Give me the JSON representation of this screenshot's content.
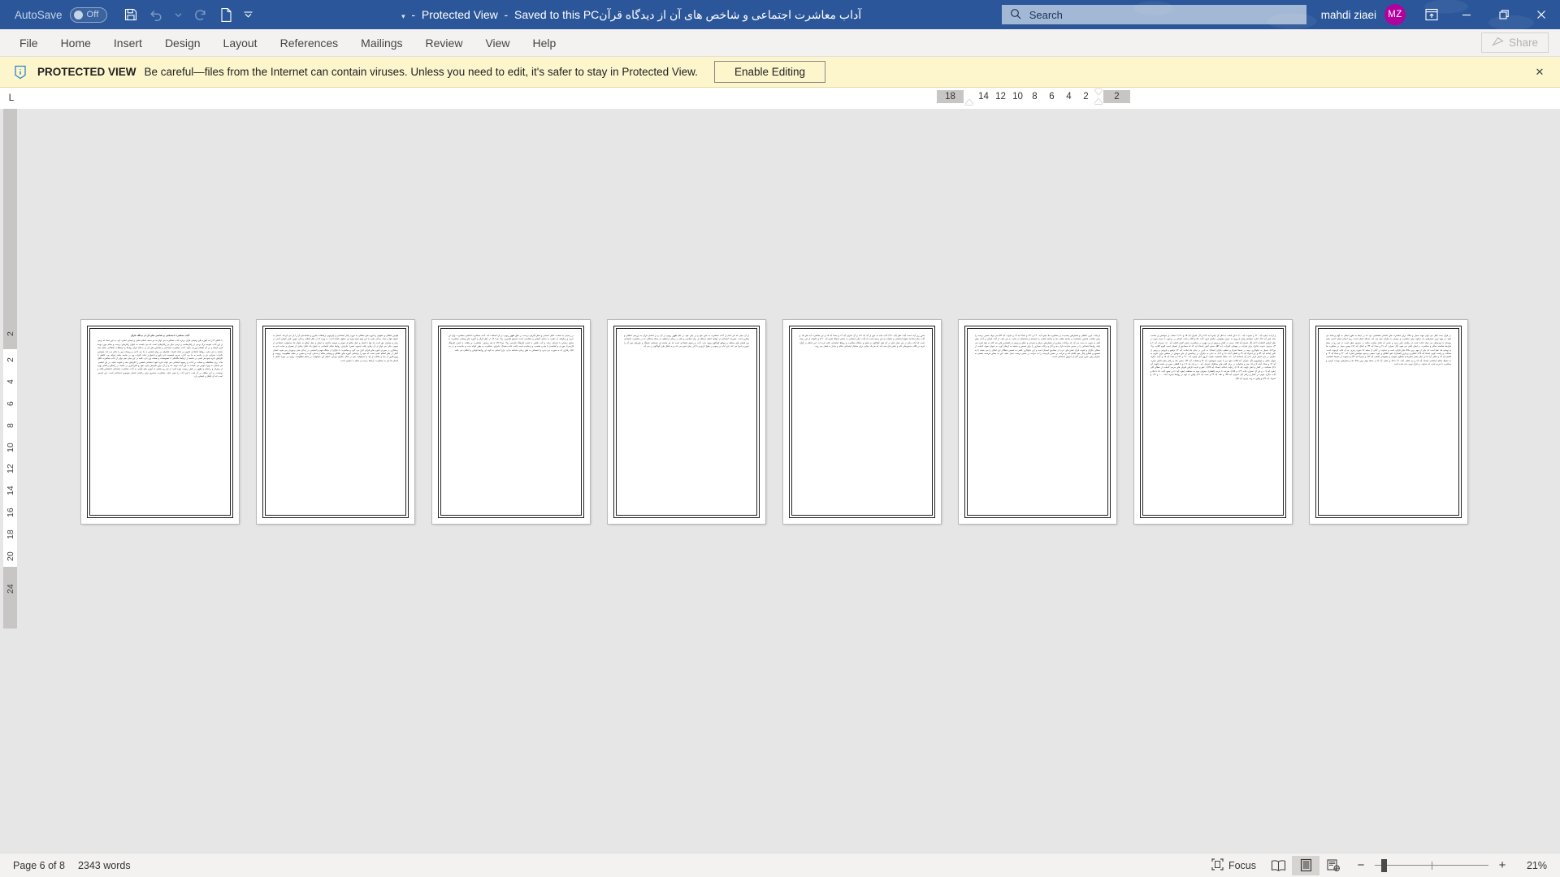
{
  "titlebar": {
    "autosave_label": "AutoSave",
    "autosave_state": "Off",
    "document_title": "آداب معاشرت اجتماعی و شاخص های آن از دیدگاه قرآن",
    "protected_view_label": "Protected View",
    "saved_location": "Saved to this PC",
    "title_dropdown_caret": "▾",
    "quick_access": [
      {
        "name": "save-icon",
        "label": "Save",
        "enabled": true
      },
      {
        "name": "undo-icon",
        "label": "Undo",
        "enabled": false
      },
      {
        "name": "undo-dropdown-icon",
        "label": "Undo options",
        "enabled": false
      },
      {
        "name": "redo-icon",
        "label": "Redo",
        "enabled": false
      },
      {
        "name": "new-document-icon",
        "label": "New",
        "enabled": true
      },
      {
        "name": "customize-quick-access-icon",
        "label": "Customize Quick Access Toolbar",
        "enabled": true
      }
    ],
    "search_placeholder": "Search",
    "account_name": "mahdi ziaei",
    "account_initials": "MZ",
    "ribbon_display_options": "Ribbon Display Options",
    "window_minimize": "Minimize",
    "window_restore": "Restore",
    "window_close": "Close"
  },
  "ribbon": {
    "tabs": [
      {
        "label": "File"
      },
      {
        "label": "Home"
      },
      {
        "label": "Insert"
      },
      {
        "label": "Design"
      },
      {
        "label": "Layout"
      },
      {
        "label": "References"
      },
      {
        "label": "Mailings"
      },
      {
        "label": "Review"
      },
      {
        "label": "View"
      },
      {
        "label": "Help"
      }
    ],
    "share_label": "Share",
    "share_enabled": false
  },
  "protected_view": {
    "badge": "PROTECTED VIEW",
    "message": "Be careful—files from the Internet can contain viruses. Unless you need to edit, it's safer to stay in Protected View.",
    "enable_button": "Enable Editing",
    "close": "✕",
    "background_color": "#fdf6cd"
  },
  "rulers": {
    "tab_stop_selector": "L",
    "horizontal_left_gray": [
      "18"
    ],
    "horizontal_numbers": [
      "14",
      "12",
      "10",
      "8",
      "6",
      "4",
      "2"
    ],
    "horizontal_right_gray": [
      "2"
    ],
    "vertical_top_gray": [
      "2"
    ],
    "vertical_numbers": [
      "2",
      "4",
      "6",
      "8",
      "10",
      "12",
      "14",
      "16",
      "18",
      "20"
    ],
    "vertical_bottom_gray": [
      "24"
    ]
  },
  "document": {
    "page_count_visible": 8,
    "zoom_level": "21%",
    "pages": [
      {
        "index": 1,
        "heading": "آداب معاشرت اجتماعی و شاخص های آن از دیدگاه قرآن",
        "body": "با نگاهی گذرا به آموزه های وحیانی قرآن درباره آداب معاشرت می توان به دو دسته احکام سلبی و ایجابی اشاره کرد. به این معنا که برخی از این آداب متوجه ترک برخی از رفتارهاست و برخی دیگر نیز رفتارهایی است که می بایست به عنوان رفتارهای درست و سالم مورد توجه قرار گرفته و بر آن اهتمام ورزیده شود. آداب معاشرت اجتماعی و شاخص های آن از دیدگاه قرآن روابط و ارتباطات اجتماعی سالم بنیاد جامعه را می سازد. روابط اجتماعی افزون بر اینکه تاثیرات شگرفی بر روان شخص به جا می گذارد و روحیات وی را متاثر می کند، همچنین تاثیرات بسزایی نیز در جامعه به جا می گذارد. هرچه شخصیت فرد قوی و استوارتر باشد تاثیرات وی در جامعه بیشتر خواهد بود. کاهش یا افزایش دایره نفوذ هر کسی در جامعه از ارتباط تنگاتنگی با خصوصیات و صفات وی دارد. البته در این میان نمی توان از آداب معاشرت غافل ماند؛ زیرا محافظت و صیانت بر آداب و رسوم اجتماعی می تواند دایره نفوذ اجتماعی شخص را افزایش دهد و تقویت نماید. بر این اساس، هر انسانی به ویژه مومن می بایست به این آداب توجه کند و از آن برای افزایش دایره نفوذ و تاثیرگذاری در جامعه در راستای زعامتی بهره از رهبران و زعیمان و ظهور در نقش ربوبیت بهره گیرد. از این رو بخشی از آموزه های قرآنی به آداب معاشرت اجتماعی اختصاص یافته و نویسنده در این مطلب بر آن شده تا این آداب را تبیین نماید. معاشرت، مسیری برای زعامتی انسان موجودی اجتماعی است. این جامعی است که آن اتفاق و اجتماع دارد."
      },
      {
        "index": 2,
        "heading": "",
        "body": "قوانین اخلاقی و حقوقی و آموزه های اخلاقی به حوزه رفتار اجتماعی و چارچوبی ارتباطات بشری و ساماندهی آن را باز می گرداند. انسان به عنوان تنها و حیات زندگی بشر، به این مهم توجه ویژه ای معلول داشته است. به ویژه که از نظر اسلام، زندگی دنیوی، قرار گرفتن آدمی در زیان و خسران حق است که تنها با ایمان و عمل صالح از سویی و توصیه دیگران به ایمان و عمل صالح به عنوان یک مسئولیت اجتماعی از سویی دیگر، می توان از آن رهایی یافت (سوره عصر). بنابراین، روابط سالم اجتماعی به عنوان یک عامل رهایی از خسران و نجات یابی به رستگاری در صورتی آموزه های قرآنی قرار می گیرد و معاشرت با دیگران از جایگاه مهم و اساسی در زندگی بشر برخوردار می شود. انسان کامل از نظر اسلام کسی است که خود را براساس آموزه های اخلاقی و وحیانی متاله و خدایی کرده و سپس در مقام مظلومیت ربوبیت و پروردگاری از خدا و خلافت از او، به مسئولیت خود در قبال دیگران بپردازد. انجام این مسئولیت در مقام مظلومیت ربوبی در حوزه تعامل با انسان ها نیاز به معاشرت، ارتباط درست و سالم با دیگران است."
      },
      {
        "index": 3,
        "heading": "",
        "body": "در رسیدن به سعادت کامل انسانی و نقش آفرینی درست در خلق ظهور ربوبی، از آن استفاده کند. آداب معاشرت اسلامی معاشرت، واژه ای عربی و برگرفته از عشره به معنای آمیختن و مصاحبت است (مجمع البحرین، ج۳، ص۴۰۲). از نظر قرآن و آموزه های وحیانی معاشرت به معنای زیستن با یکدیگر، رفت و آمد داشتن با کسی (فرهنگ فارسی، ج۴، ص۴۲۱۲) یا هم زیستن، معاشرت و رفاقت با کسی (فرهنگ فارسی)، خوردن و آشامیدن با هم و نشست و برخاست است (لغت نامه دهخدا). بنابراین، معاشرت به طور کوتاه مدت و بلندمدت و در حد اعلا، رفتاری که به صورت می پذیرد و اختصاص به طور زمانی شناخته ندارد. برای اساس به گونه ای روابط قوانین و اخلاقی می باشد."
      },
      {
        "index": 4,
        "heading": "",
        "body": "از آن جایی که هر کدام از آداب معاشرت به جای خود و در جای خود در علم ظهور ربوبی از آن، و بر اساس قرآن به بررسی اخلاقی و رفتاری است. مقررات اجتماعی از عوامل اصلی ارتباط، از زبان شناسی و علم در زندگی ارتباطی، از جمله مسائلی که در معاشرت اجتماعی بین انسان های مختلف و جوامع گوناگون وجود دارد، آداب و رسوم اجتماعی است که هر جامعه ای براساس فرهنگ و باورهای خود آن را تدوین و اجرا می کند. این آداب و رسوم در طول تاریخ و با گذر زمان تغییر می کند و به شکل های گوناگون در می آید."
      },
      {
        "index": 5,
        "heading": "",
        "body": "مقرر زیر آیت است آیات نظر (آیه ۲۲۱) آداب ماند به حق از آیه آیه ۱۶۶ و آل عمران آیه ۱۳ و نساء آیه ۱۵ و نیز معاشرت آیه های ۱۵ و آیات دیگر (مائده) حقوق اجتماعی و خانواده از این زمینه است که آیات دیگر اجتماعی به معنای ارتباط (بقره آیه ۲۲۰) و خانواده از این زمینه است که آیات دیگر در این میان حکم در آیه های گوناگون بر نقش و جایگاه معاشرت و روابط اجتماعی تاکید کرده اند. این احکام در قرآن کریم در قالب دستورهای عام و خاص بیان شده اند که هر یک مبنایی برای ساختار اجتماعی سالم و پایدار به شمار می روند."
      },
      {
        "index": 6,
        "heading": "",
        "body": "مراعات عرف اخلاقی و هنجارهای پسندیده در معاشرت ها (بقره آیه ۲۲۰ و ۲۳۱ و نساء آیه ۱۹ و احزاب آیه ۵۳) می تواند مسیر درست را برای سلامت شخص، شخصیت و جامعه نشان دهد و جامعه ایمانی را منسجم و مستحکم تر سازد. به هر حال، از آیات قرآنی و آداب پیش گفته به خوبی به دست می آید که مراعات بسیاری از هنجارهای عرفی و شرعی و عقلی و پرهیز از ناهنجاری های سه گانه نه تنها اجازه می تواند روابط اجتماعی را در مسیر سازنده قرار دهد و آثار و برکات بسیاری را برای شخص و جامعه به ارمغان آورد. به عنوان نمونه گذشت از خطای دیگران و تقویت قرآن نقش های عرب از مصادیق احسان است و این نیکوکاری عملی به شخص خطاکار این امکان را می بخشد تا به تصحیح و اصلاح رفتار خود اقدام کند و حرکت در مسیر نادرست را به حرکت در مسیر درست تبدیل نماید. این به معنای فرصت بخشی به دیگران برای خارج کردن آنان از انزوای اجتماعی است."
      },
      {
        "index": 7,
        "heading": "",
        "body": "و ارادت (بقره آیه ۲۲۰ و حجرات آیه ۱۰)، ادای امانت به اهل آن (بقره آیه ۲۸۳ و آل عمران آیه ۷۵ و ۱۶۱)، اجتناب از خواستن از صاحب خانه (نور آیه ۲۷)، اجازه خواستن پیش از ورود به حریم خصوصی دیگران (نور، آیات ۵۸ و ۵۹)، رعایت انصاف در برخورد با مردم بدون در نظر گرفتن اعتقادات آنان (آل عمران آیه ۷۵)، نرمی در گفتار و پرهیز از بی مهری در معاشرت، سخن گفتن (انعام، آیه ۱۰)، حجرات آیه ۲ و ۴)، پذیرش دعوت دیگران برای شرکت در مهمانی (احزاب، آیه ۵۳)، سخن گفتن (نساء، آیه ۸۶ که مصادیق از احسان است الیوم الثانی، ج۲، ص۷۶)، تعجیل به نیکوکاری، وجه در حفظ احترام و تعظیم دیگران (نساء)، نه نادرز در نیکی ها (مائده، آیه ۲)، تواضع و فروتنی و پرهیز از تکبر (مائده آیه ۵۴ و نیز اسراء آیه ۳۷ و لقمان آیات ۱۸ و ۱۹)، به دادن به دیگران در برخاستن از جای خویش در مجلس برای تکریم به دیگران در غیر اختیار قرار دادن آن (مجادله آیه ۱۱)، حفظ شخصیت افراد، آبروی آنان (بقره، آیه ۲۲۰ و ۲۶۳ و نساء آیه ۱۵ و آیات دیگر)، خوش خلقی و خوشرویی (آل عمران، آیه ۱۵۹)، دفع بدی با خوبی (مومنون، آیه ۹۶ و فصلت، آیه ۳۴)، سخن نیک و رفتار نیکو داشتن (بقره، آیه ۸۳ و نساء، آیات ۵ و ۸)، صبر و شکیبایی در برابر گفته های مخالفان (مزمل، آیه ۱۰ و بلد، آیه ۱۷) و یا الطاف سوره و جامعه (کهف آیه ۲۸)، صداقت در گفتار و اصل (توبه، آیه ۱۱۹)، رعایت عدالت (نساء، آیه ۱۳۵)، عفو و نادیده گرفتن لغزش های مردم، گذشت از خطای آنان (بقره آیه ۱۰۹ و نیز آل عمران، آیات ۱۳۴ و ۱۵۹)، شرکت با مردم (لقمان)، معرفی خود به مخاطب (هود، آیه ۸۱ و جمع، آیات ۵۱ تا ۵۸ و آیات دیگر)، خوبی در گفتار و رفتار (آل عمران، آیه ۱۵۹ و طه، آیه ۴۴ و مجد، آیه ۲۷)، وفای به عهد در روابط (بقره، آیات ۱۰۰ و ۱۲۷ و اسراء، آیه ۳۴) و وفای به وعد (مریم آیه ۵۴)."
      },
      {
        "index": 8,
        "heading": "",
        "body": "در قرآن بحث قابل می توان جهت معیار و ملاک برای معاشرت های انسانی شناسایی کرد که در اینجا به طور اجمال به آنها پرداخته می شود. از مهم ترین معیارهایی که خداوند برای معاشرت و دوستی با دیگران بیان می کند، مساله ایمان است؛ زیرا انسان همان اندازه میان مومنان با خودمختار می تواند اثبات است از دیگران تاثیر پذیرد و کسی که کامل نماینده نباشد در معرض خطر است. از این رو از جمله شرایط شایسته سالی و معاشرت در ایمان تلقی می شود. (آل عمران، آیه ۲۷ و نساء آیه ۱۴۴ و انفال، آیه ۷۲) دومین معیار در معاشرت ها و دوستی ها، تقوا است که یکی از مهم ترین ملاک های قرآنی است و خداوند در آیاتی از جمله ۶۷ سوره زخرف به آن تاکید فرموده است. صداقت و راست گویی (نساء آیه ۶۹)، اصلاح و بردباری (لقمان)، عفو اخلاقی و خوب جمعی و سود خواستن (بقره، آیه ۲۲۰ و نساء آیه ۱۴ و لقمان آیه ۱۵ و غافر، آیه ۲) از دیگر معیار معیارها و مصالح عمومی و خصوصی (انعام، آیه ۱۵۲ و اسراء آیه ۳۴) و عمویت از محیط نامناسب به محیط سالم اجتماعی (نساء، آیه ۸۳ و نیز انفال، آیات ۷۲ تا ۷۵ و حشر، آیه ۷) از جمله مهم ترین ملاک ها و معیارهای دوست گزینی و معاشرت با مردم است که خداوند در قرآن توجه داده شده است."
      }
    ]
  },
  "statusbar": {
    "page_indicator": "Page 6 of 8",
    "word_count": "2343 words",
    "focus_label": "Focus",
    "view_modes": [
      {
        "name": "read-mode-icon",
        "label": "Read Mode",
        "active": false
      },
      {
        "name": "print-layout-icon",
        "label": "Print Layout",
        "active": true
      },
      {
        "name": "web-layout-icon",
        "label": "Web Layout",
        "active": false
      }
    ],
    "zoom_out": "−",
    "zoom_in": "+",
    "zoom_level": "21%"
  },
  "colors": {
    "titlebar": "#2b579a",
    "accent": "#2b579a",
    "avatar": "#b4009e",
    "protected_banner": "#fdf6cd",
    "workspace": "#e6e6e6",
    "ribbon": "#f3f2f1"
  }
}
